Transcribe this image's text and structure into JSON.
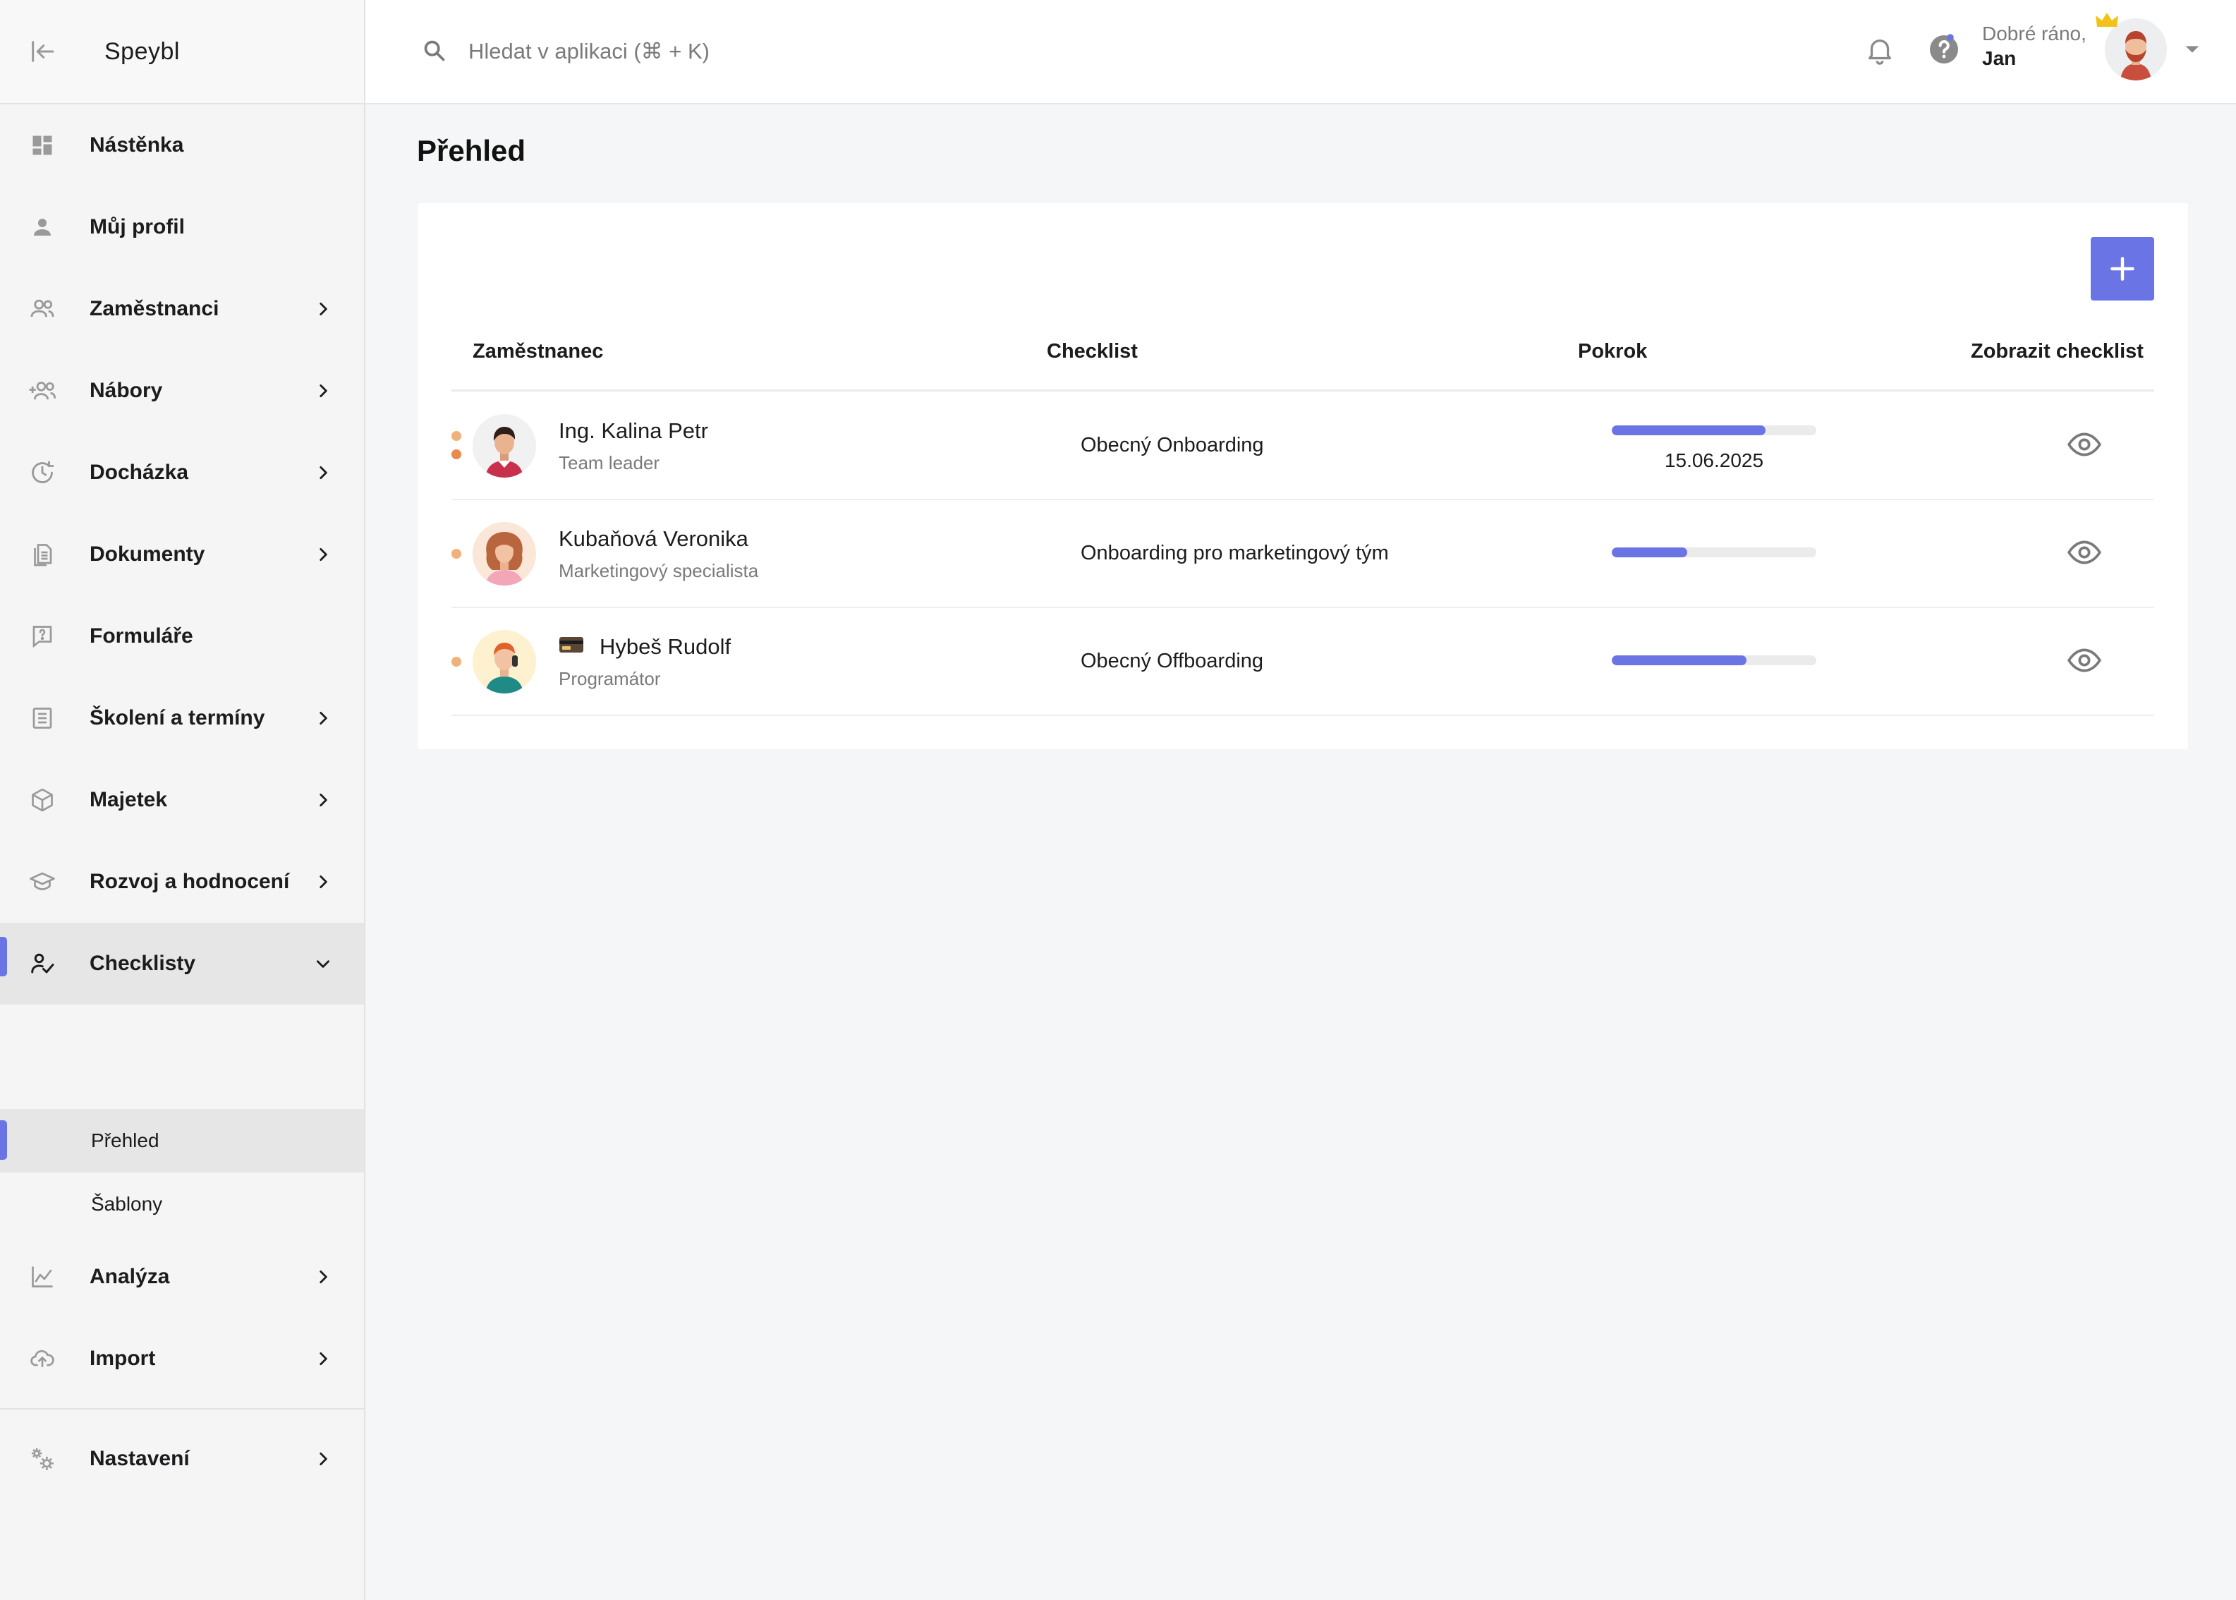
{
  "app": {
    "brand": "Speybl"
  },
  "search": {
    "placeholder": "Hledat v aplikaci (⌘ + K)",
    "value": ""
  },
  "user": {
    "greeting": "Dobré ráno,",
    "name": "Jan"
  },
  "sidebar": {
    "items": [
      {
        "label": "Nástěnka",
        "icon": "dashboard-icon",
        "has_chevron": false
      },
      {
        "label": "Můj profil",
        "icon": "person-icon",
        "has_chevron": false
      },
      {
        "label": "Zaměstnanci",
        "icon": "people-icon",
        "has_chevron": true
      },
      {
        "label": "Nábory",
        "icon": "add-people-icon",
        "has_chevron": true
      },
      {
        "label": "Docházka",
        "icon": "clock-icon",
        "has_chevron": true
      },
      {
        "label": "Dokumenty",
        "icon": "documents-icon",
        "has_chevron": true
      },
      {
        "label": "Formuláře",
        "icon": "form-question-icon",
        "has_chevron": false
      },
      {
        "label": "Školení a termíny",
        "icon": "calendar-list-icon",
        "has_chevron": true
      },
      {
        "label": "Majetek",
        "icon": "box-icon",
        "has_chevron": true
      },
      {
        "label": "Rozvoj a hodnocení",
        "icon": "graduation-cap-icon",
        "has_chevron": true
      },
      {
        "label": "Checklisty",
        "icon": "person-check-icon",
        "has_chevron": true,
        "expanded": true
      },
      {
        "label": "Analýza",
        "icon": "chart-line-icon",
        "has_chevron": true
      },
      {
        "label": "Import",
        "icon": "cloud-upload-icon",
        "has_chevron": true
      },
      {
        "label": "Nastavení",
        "icon": "gears-icon",
        "has_chevron": true
      }
    ],
    "checklisty_sub": [
      {
        "label": "Přehled",
        "active": true
      },
      {
        "label": "Šablony",
        "active": false
      }
    ]
  },
  "main": {
    "title": "Přehled",
    "table": {
      "columns": [
        "Zaměstnanec",
        "Checklist",
        "Pokrok",
        "Zobrazit checklist"
      ],
      "rows": [
        {
          "name": "Ing. Kalina Petr",
          "role": "Team leader",
          "checklist": "Obecný Onboarding",
          "progress": 0.75,
          "due_date": "15.06.2025",
          "dots": 2,
          "avatar": "male-avatar-dark-hair"
        },
        {
          "name": "Kubaňová Veronika",
          "role": "Marketingový specialista",
          "checklist": "Onboarding pro marketingový tým",
          "progress": 0.37,
          "due_date": "",
          "dots": 1,
          "avatar": "female-avatar-curly-hair"
        },
        {
          "name": "Hybeš Rudolf",
          "role": "Programátor",
          "checklist": "Obecný Offboarding",
          "progress": 0.66,
          "due_date": "",
          "dots": 1,
          "avatar": "male-avatar-red-hair",
          "badge": "card-badge-icon"
        }
      ]
    }
  },
  "colors": {
    "accent": "#6b74e4",
    "status_dot": "#f0b27a",
    "status_dot_strong": "#ea8a4c",
    "crown": "#f3c21a"
  }
}
